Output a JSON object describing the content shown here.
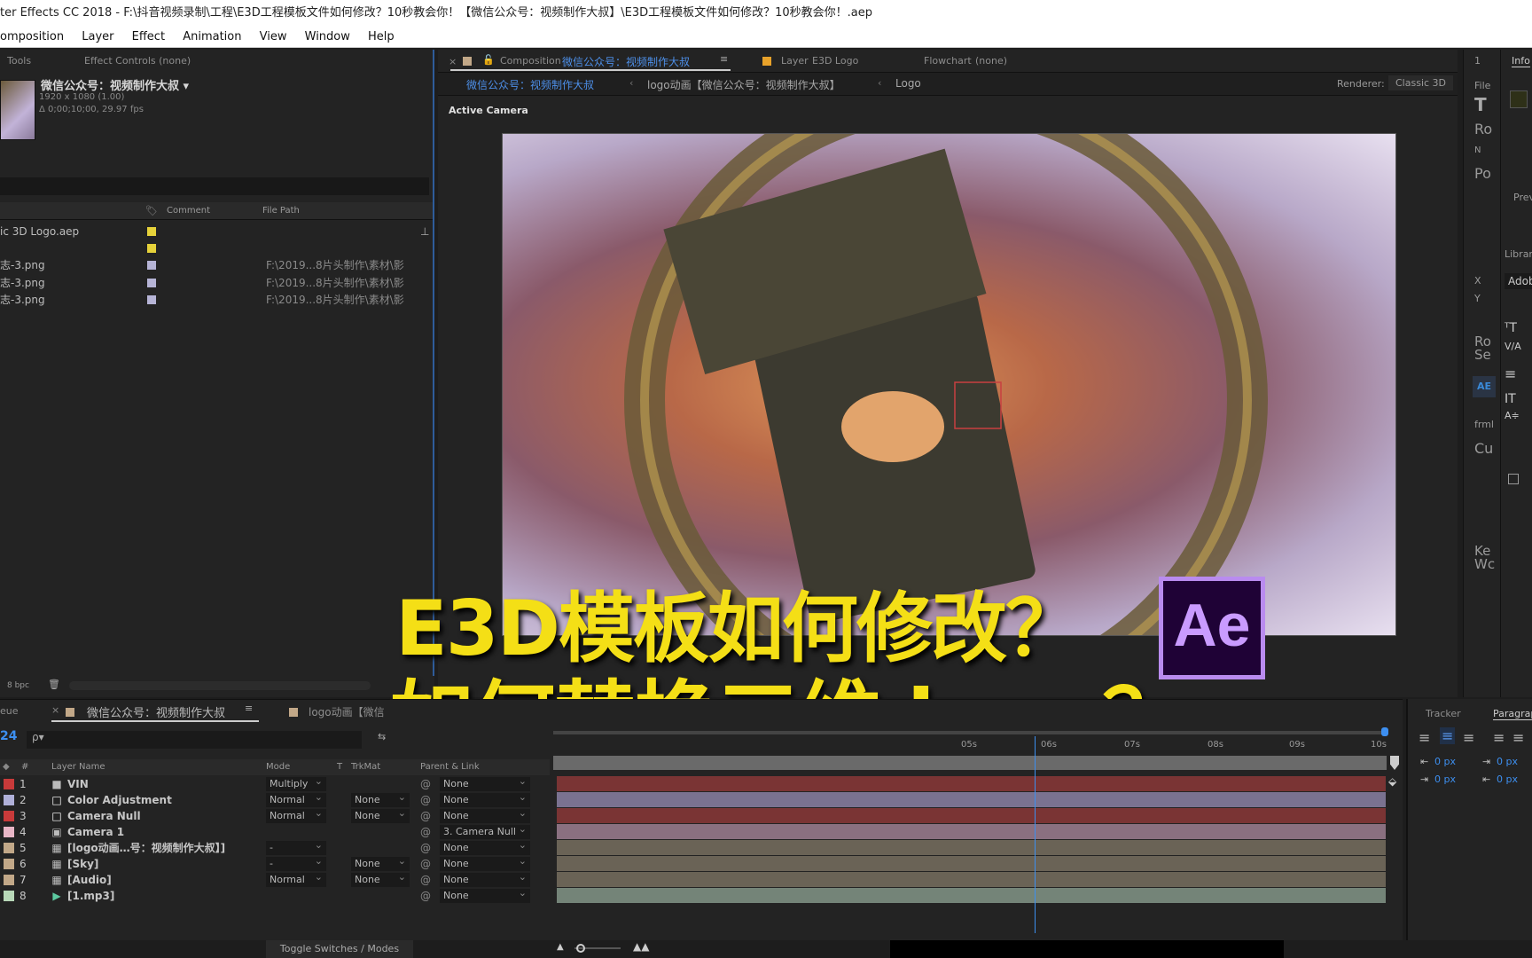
{
  "titlebar": {
    "title": "ter Effects CC 2018 - F:\\抖音视频录制\\工程\\E3D工程模板文件如何修改？10秒教会你！【微信公众号：视频制作大叔】\\E3D工程模板文件如何修改？10秒教会你！.aep"
  },
  "menubar": {
    "items": [
      "omposition",
      "Layer",
      "Effect",
      "Animation",
      "View",
      "Window",
      "Help"
    ]
  },
  "left_panel": {
    "tabs": [
      "Tools",
      "Effect Controls (none)"
    ],
    "project": {
      "name": "微信公众号：视频制作大叔 ▾",
      "resolution": "1920 x 1080 (1.00)",
      "duration": "Δ 0;00;10;00, 29.97 fps"
    },
    "columns": {
      "comment": "Comment",
      "file_path": "File Path"
    },
    "items": [
      {
        "name": "ic 3D Logo.aep",
        "color": "#e6d23a",
        "path": ""
      },
      {
        "name": "",
        "color": "#e6d23a",
        "path": ""
      },
      {
        "name": "志-3.png",
        "color": "#b6b4d6",
        "path": "F:\\2019...8片头制作\\素材\\影"
      },
      {
        "name": "志-3.png",
        "color": "#b6b4d6",
        "path": "F:\\2019...8片头制作\\素材\\影"
      },
      {
        "name": "志-3.png",
        "color": "#b6b4d6",
        "path": "F:\\2019...8片头制作\\素材\\影"
      }
    ],
    "footer": {
      "bpc": "8 bpc"
    }
  },
  "viewer": {
    "tabs": [
      {
        "prefix": "Composition",
        "name": "微信公众号：视频制作大叔"
      },
      {
        "prefix": "Layer",
        "name": "E3D Logo"
      },
      {
        "prefix": "Flowchart",
        "name": "(none)"
      }
    ],
    "breadcrumbs": [
      "微信公众号：视频制作大叔",
      "logo动画【微信公众号：视频制作大叔】",
      "Logo"
    ],
    "renderer_label": "Renderer:",
    "renderer_value": "Classic 3D",
    "camera_label": "Active Camera"
  },
  "right_strip": {
    "items": [
      "1",
      "File",
      "T",
      "Ro",
      "N",
      "Po",
      "X",
      "Y",
      "Ro Se",
      "AE",
      "frml",
      "Cu",
      "Ke Wc"
    ]
  },
  "right_panel": {
    "tabs": [
      "Info",
      "Prev",
      "Librari",
      "Adob"
    ]
  },
  "overlay": {
    "line1": "E3D模板如何修改？",
    "line2": "如何替换三维 logo？",
    "badge": "Ae"
  },
  "timeline": {
    "tabs": [
      "eue",
      "微信公众号：视频制作大叔",
      "logo动画【微信"
    ],
    "search_placeholder": "ρ▾",
    "time_display": "24",
    "columns": {
      "num": "#",
      "layer_name": "Layer Name",
      "mode": "Mode",
      "t": "T",
      "trkmat": "TrkMat",
      "parent": "Parent & Link"
    },
    "ruler": [
      "05s",
      "06s",
      "07s",
      "08s",
      "09s",
      "10s"
    ],
    "layers": [
      {
        "num": "1",
        "name": "VIN",
        "label": "#c83a3a",
        "icon": "solid-black",
        "mode": "Multiply",
        "trkmat": "",
        "parent": "None",
        "bar": "#7a3434"
      },
      {
        "num": "2",
        "name": "Color Adjustment",
        "label": "#b0b0d8",
        "icon": "solid-white",
        "mode": "Normal",
        "trkmat": "None",
        "parent": "None",
        "bar": "#7a7290"
      },
      {
        "num": "3",
        "name": "Camera Null",
        "label": "#c83a3a",
        "icon": "solid-white",
        "mode": "Normal",
        "trkmat": "None",
        "parent": "None",
        "bar": "#7a3434"
      },
      {
        "num": "4",
        "name": "Camera 1",
        "label": "#e8b6c6",
        "icon": "camera",
        "mode": "",
        "trkmat": "",
        "parent": "3. Camera Null",
        "bar": "#8a7080"
      },
      {
        "num": "5",
        "name": "[logo动画…号：视频制作大叔】]",
        "label": "#c2a888",
        "icon": "comp",
        "mode": "-",
        "trkmat": "",
        "parent": "None",
        "bar": "#6a6356"
      },
      {
        "num": "6",
        "name": "[Sky]",
        "label": "#c2a888",
        "icon": "comp",
        "mode": "-",
        "trkmat": "None",
        "parent": "None",
        "bar": "#6a6356"
      },
      {
        "num": "7",
        "name": "[Audio]",
        "label": "#c2a888",
        "icon": "comp",
        "mode": "Normal",
        "trkmat": "None",
        "parent": "None",
        "bar": "#6a6356"
      },
      {
        "num": "8",
        "name": "[1.mp3]",
        "label": "#b8d8b8",
        "icon": "audio",
        "mode": "",
        "trkmat": "",
        "parent": "None",
        "bar": "#748478"
      }
    ],
    "footer": "Toggle Switches / Modes"
  },
  "right_bottom": {
    "tabs": [
      "Tracker",
      "Paragrap"
    ],
    "indent_values": [
      "0 px",
      "0 px",
      "0 px",
      "0 px"
    ]
  }
}
